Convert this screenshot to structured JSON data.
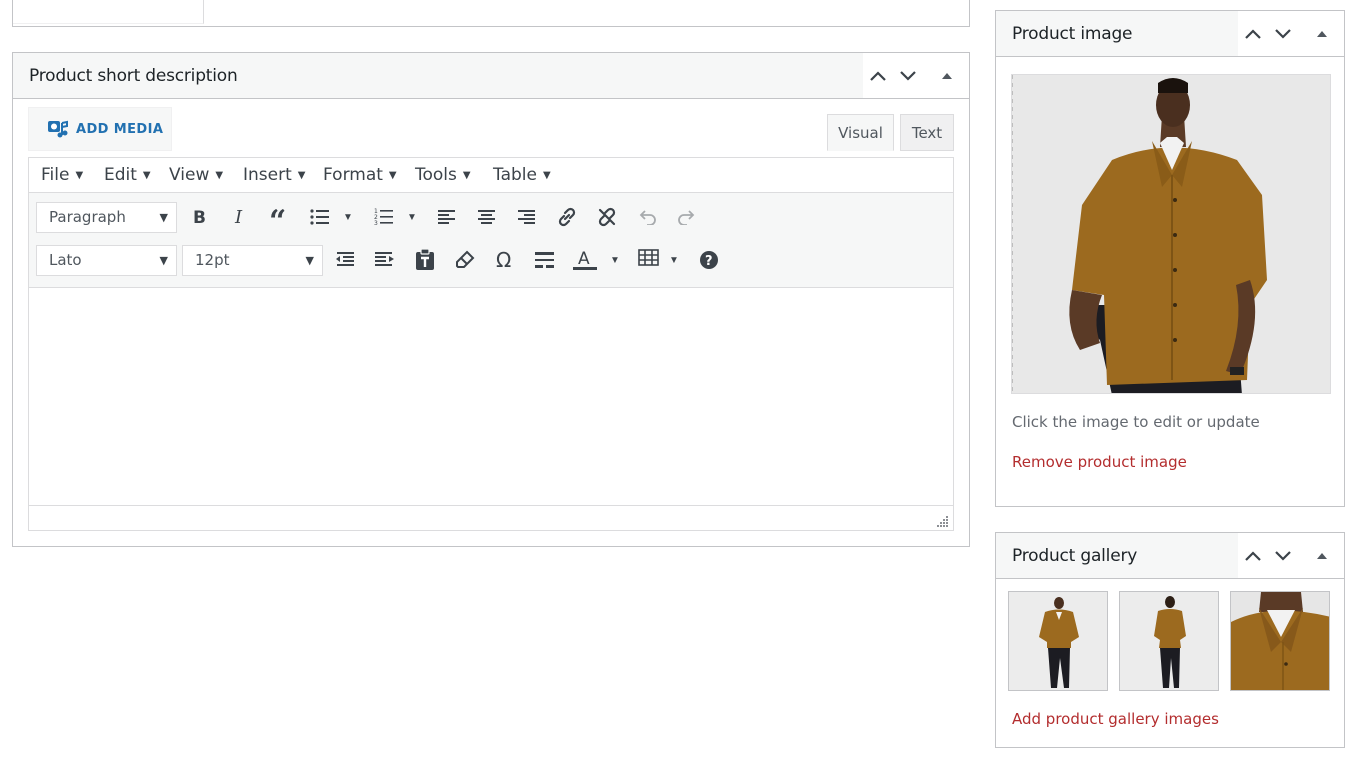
{
  "short_description": {
    "title": "Product short description",
    "add_media_label": "ADD MEDIA",
    "tabs": {
      "visual": "Visual",
      "text": "Text"
    },
    "menu": [
      "File",
      "Edit",
      "View",
      "Insert",
      "Format",
      "Tools",
      "Table"
    ],
    "format_select": "Paragraph",
    "font_select": "Lato",
    "size_select": "12pt",
    "toolbar_row1": [
      "bold-icon",
      "italic-icon",
      "blockquote-icon",
      "bullet-list-icon",
      "numbered-list-icon",
      "align-left-icon",
      "align-center-icon",
      "align-right-icon",
      "link-icon",
      "unlink-icon",
      "undo-icon",
      "redo-icon"
    ],
    "toolbar_row2": [
      "outdent-icon",
      "indent-icon",
      "paste-text-icon",
      "clear-formatting-icon",
      "special-character-icon",
      "horizontal-line-icon",
      "text-color-icon",
      "table-icon",
      "help-icon"
    ]
  },
  "product_image": {
    "title": "Product image",
    "hint": "Click the image to edit or update",
    "remove_label": "Remove product image"
  },
  "product_gallery": {
    "title": "Product gallery",
    "add_label": "Add product gallery images",
    "image_count": 3
  },
  "colors": {
    "link_red": "#b32d2e",
    "accent_blue": "#2271b1",
    "shirt_mustard": "#9c6a1f"
  }
}
